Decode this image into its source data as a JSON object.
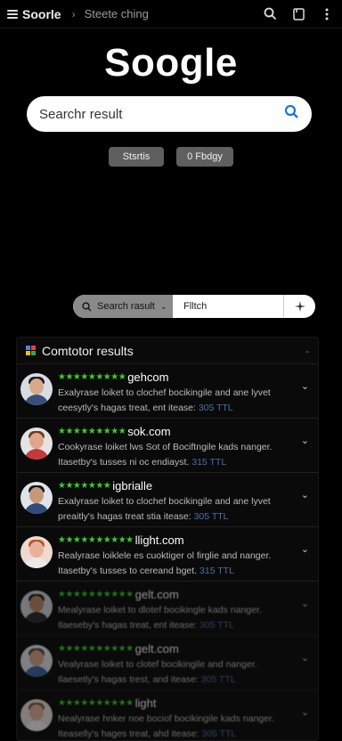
{
  "topbar": {
    "app_title": "Soorle",
    "breadcrumb": "Steete ching",
    "icons": [
      "search-icon",
      "bookmark-icon",
      "more-vertical-icon"
    ]
  },
  "logo": "Soogle",
  "search": {
    "placeholder": "Searchr result",
    "icon": "search-icon",
    "accent": "#1a73e8"
  },
  "buttons": {
    "primary_label": "Stsrtis",
    "secondary_label": "0 Fbdgy"
  },
  "filter": {
    "dropdown_label": "Search rasult",
    "text": "Flltch",
    "icon": "sparkle-icon"
  },
  "results_panel": {
    "title": "Comtotor results",
    "collapse_glyph": "-",
    "star_color": "#3ccc2a",
    "items": [
      {
        "title": "gehcom",
        "stars": "★★★★★★★★★",
        "snippet1": "Exalyrase loiket to clochef bocikingile and ane lyvet",
        "snippet2": "ceesytly's hagas treat, ent itease: ",
        "meta": "305 TTL"
      },
      {
        "title": "sok.com",
        "stars": "★★★★★★★★★",
        "snippet1": "Cookyrase loiket lws Sot of Bociftngile kads nanger.",
        "snippet2": "Itasetby's tusses ni oc endiayst. ",
        "meta": "315 TTL"
      },
      {
        "title": "igbrialle",
        "stars": "★★★★★★★",
        "snippet1": "Exalyrase loiket to clochef bocikingile and ane lyvet",
        "snippet2": "preaitly's hagas treat stia itease: ",
        "meta": "305 TTL"
      },
      {
        "title": "llight.com",
        "stars": "★★★★★★★★★★",
        "snippet1": "Realyrase loiklele es cuoktiger ol firglie and nanger.",
        "snippet2": "Itasetby's tusses to cereand bget. ",
        "meta": "315 TTL"
      },
      {
        "title": "gelt.com",
        "stars": "★★★★★★★★★★",
        "snippet1": "Mealyrase loiket to dlotef bocikingle kads nanger.",
        "snippet2": "Ilaeseby's hagas treat, ent itease: ",
        "meta": "305 TTL"
      },
      {
        "title": "gelt.com",
        "stars": "★★★★★★★★★★",
        "snippet1": "Vealyrase loiket to clotef bocikingile and nanger.",
        "snippet2": "Ilaesetly's hagas trest, and itease: ",
        "meta": "305 TTL"
      },
      {
        "title": "light",
        "stars": "★★★★★★★★★★",
        "snippet1": "Nealyrase hnker noe bociof bocikingile kads nanger.",
        "snippet2": "Iteaselly's hages treat, ahd itease: ",
        "meta": "305 TTL"
      }
    ]
  }
}
